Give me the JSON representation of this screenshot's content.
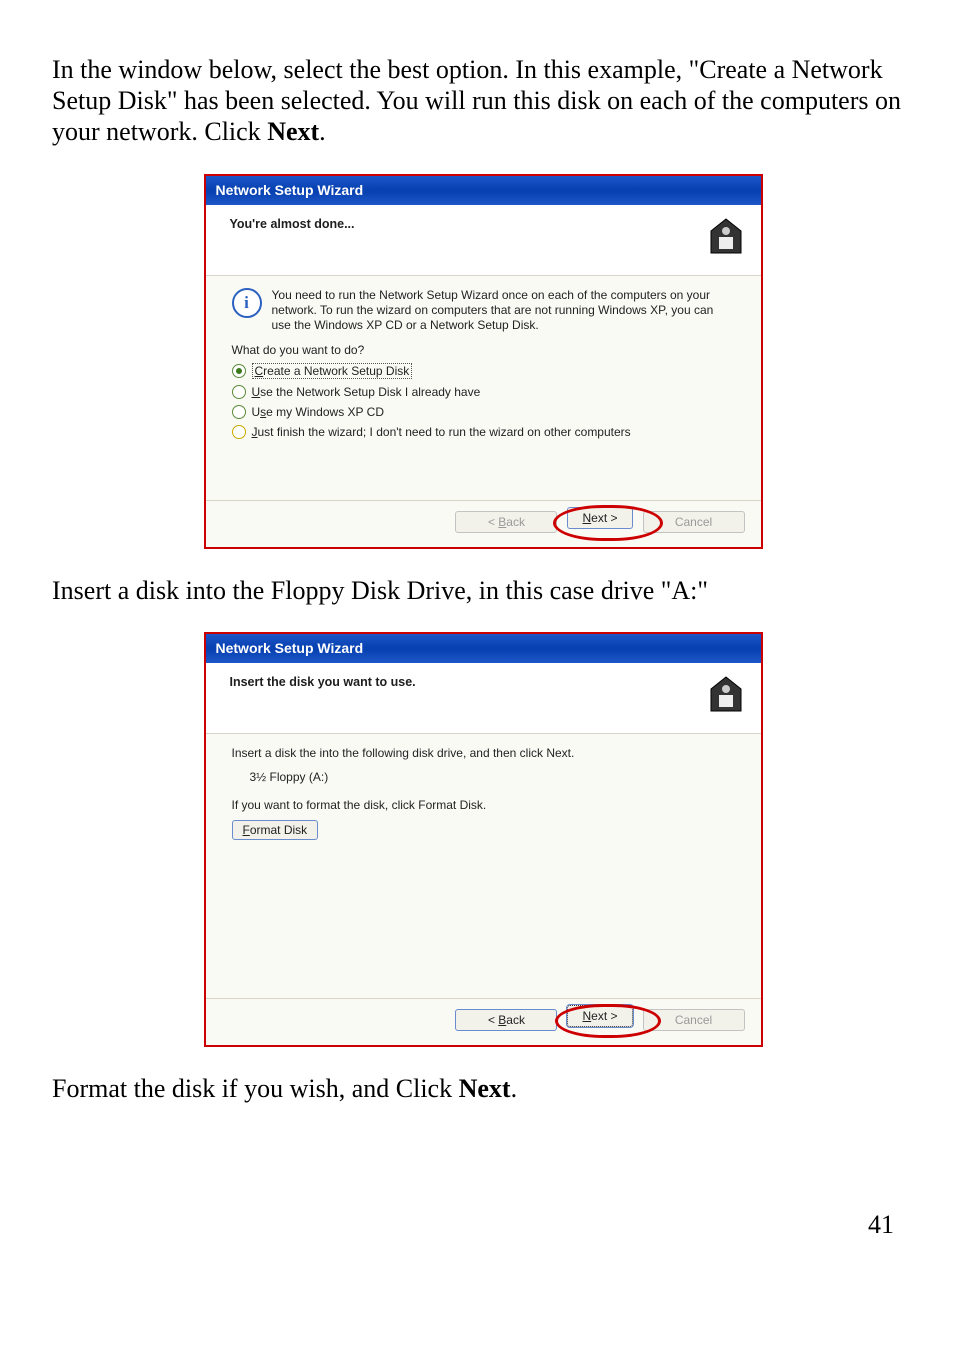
{
  "intro_text_part1": "In the window below, select the best option.  In this example, \"Create a Network Setup Disk\" has been selected.  You will run this disk on each of the computers on your network.  Click ",
  "intro_bold": "Next",
  "intro_text_part2": ".",
  "dialog1": {
    "title": "Network Setup Wizard",
    "header": "You're almost done...",
    "info": "You need to run the Network Setup Wizard once on each of the computers on your network. To run the wizard on computers that are not running Windows XP, you can use the Windows XP CD or a Network Setup Disk.",
    "question": "What do you want to do?",
    "options": {
      "opt1": "Create a Network Setup Disk",
      "opt2": "Use the Network Setup Disk I already have",
      "opt3": "Use my Windows XP CD",
      "opt4": "Just finish the wizard; I don't need to run the wizard on other computers"
    },
    "buttons": {
      "back": "< Back",
      "next": "Next >",
      "cancel": "Cancel"
    }
  },
  "middle_text": "Insert a disk into the Floppy Disk Drive, in this case drive \"A:\"",
  "dialog2": {
    "title": "Network Setup Wizard",
    "header": "Insert the disk you want to use.",
    "line1": "Insert a disk the into the following disk drive, and then click Next.",
    "drive": "3½ Floppy (A:)",
    "line2": "If you want to format the disk, click Format Disk.",
    "format_btn": "Format Disk",
    "buttons": {
      "back": "< Back",
      "next": "Next >",
      "cancel": "Cancel"
    }
  },
  "closing_part1": "Format the disk if you wish, and Click ",
  "closing_bold": "Next",
  "closing_part2": ".",
  "page_number": "41"
}
